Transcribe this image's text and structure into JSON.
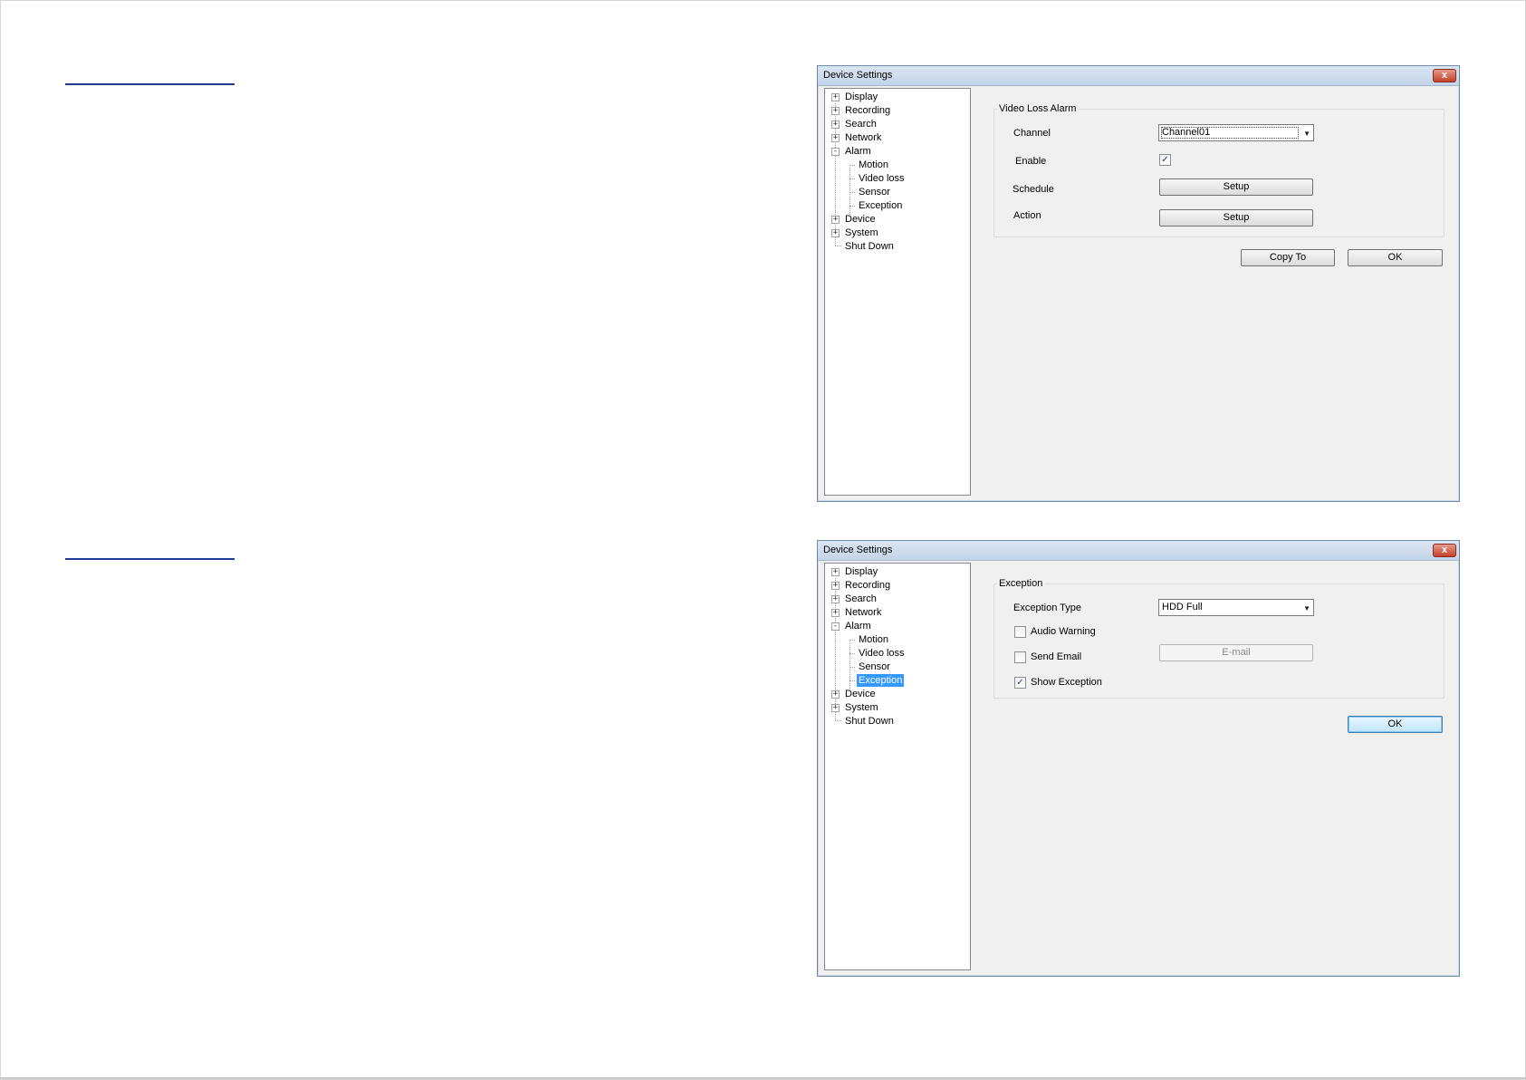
{
  "dialog1": {
    "title": "Device Settings",
    "close_glyph": "x",
    "tree": [
      {
        "label": "Display",
        "toggle": "+"
      },
      {
        "label": "Recording",
        "toggle": "+"
      },
      {
        "label": "Search",
        "toggle": "+"
      },
      {
        "label": "Network",
        "toggle": "+"
      },
      {
        "label": "Alarm",
        "toggle": "-"
      },
      {
        "label": "Motion"
      },
      {
        "label": "Video loss"
      },
      {
        "label": "Sensor"
      },
      {
        "label": "Exception"
      },
      {
        "label": "Device",
        "toggle": "+"
      },
      {
        "label": "System",
        "toggle": "+"
      },
      {
        "label": "Shut Down"
      }
    ],
    "group_title": "Video Loss Alarm",
    "channel_label": "Channel",
    "channel_value": "Channel01",
    "enable_label": "Enable",
    "enable_checked": "✓",
    "schedule_label": "Schedule",
    "schedule_button": "Setup",
    "action_label": "Action",
    "action_button": "Setup",
    "copy_button": "Copy To",
    "ok_button": "OK"
  },
  "dialog2": {
    "title": "Device Settings",
    "close_glyph": "x",
    "tree": [
      {
        "label": "Display",
        "toggle": "+"
      },
      {
        "label": "Recording",
        "toggle": "+"
      },
      {
        "label": "Search",
        "toggle": "+"
      },
      {
        "label": "Network",
        "toggle": "+"
      },
      {
        "label": "Alarm",
        "toggle": "-"
      },
      {
        "label": "Motion"
      },
      {
        "label": "Video loss"
      },
      {
        "label": "Sensor"
      },
      {
        "label": "Exception"
      },
      {
        "label": "Device",
        "toggle": "+"
      },
      {
        "label": "System",
        "toggle": "+"
      },
      {
        "label": "Shut Down"
      }
    ],
    "selected_item": "Exception",
    "group_title": "Exception",
    "exception_type_label": "Exception Type",
    "exception_type_value": "HDD Full",
    "audio_warning_label": "Audio Warning",
    "send_email_label": "Send Email",
    "email_button": "E-mail",
    "show_exception_label": "Show Exception",
    "show_exception_checked": "✓",
    "ok_button": "OK"
  },
  "colors": {
    "section_rule": "#1f3a93",
    "selection": "#3399ff",
    "dialog_bg": "#f0f0f0"
  }
}
